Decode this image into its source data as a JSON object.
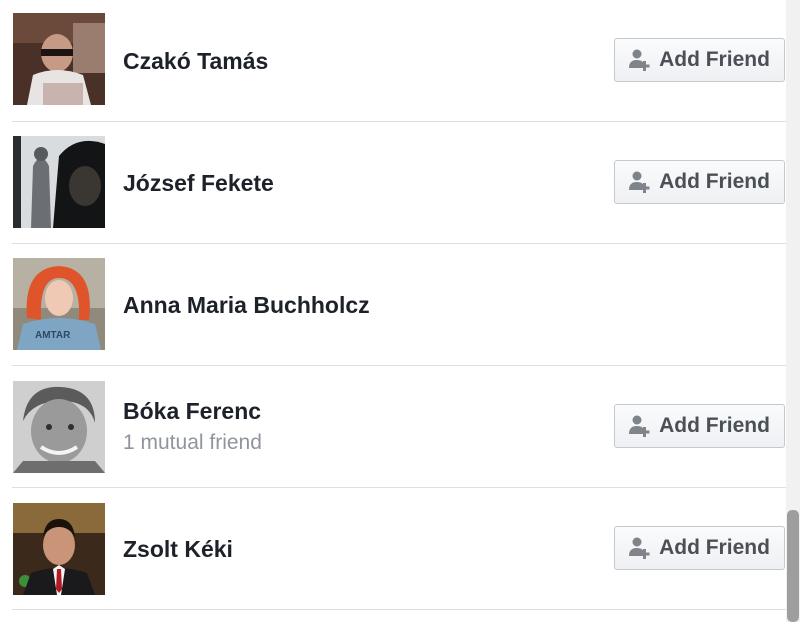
{
  "people": [
    {
      "name": "Czakó Tamás",
      "mutual": "",
      "button": "Add Friend",
      "avatar": "person-with-glasses-reading-photo"
    },
    {
      "name": "József Fekete",
      "mutual": "",
      "button": "Add Friend",
      "avatar": "hooded-figure-photo"
    },
    {
      "name": "Anna Maria Buchholcz",
      "mutual": "",
      "button": "",
      "avatar": "red-haired-woman-photo"
    },
    {
      "name": "Bóka Ferenc",
      "mutual": "1 mutual friend",
      "button": "Add Friend",
      "avatar": "smiling-man-bw-photo"
    },
    {
      "name": "Zsolt Kéki",
      "mutual": "",
      "button": "Add Friend",
      "avatar": "man-in-suit-photo"
    }
  ],
  "icons": {
    "add_friend": "add-friend-icon"
  },
  "colors": {
    "name": "#1d2129",
    "mutual": "#90949c",
    "button_text": "#4b4f56",
    "divider": "#dddfe2"
  }
}
